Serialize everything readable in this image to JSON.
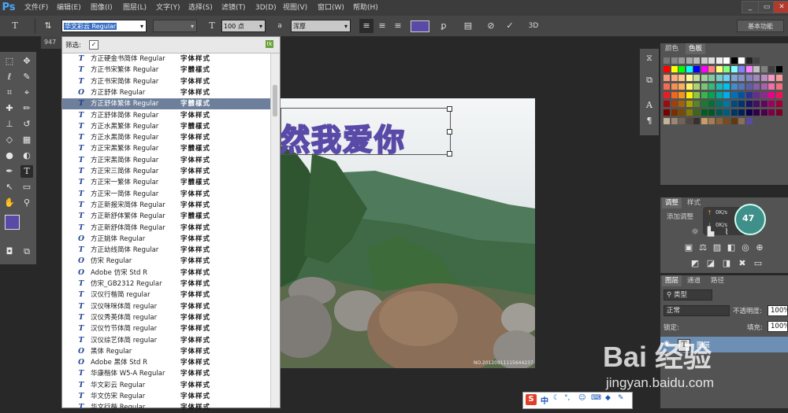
{
  "app": {
    "logo": "Ps"
  },
  "menu": [
    "文件(F)",
    "编辑(E)",
    "图像(I)",
    "图层(L)",
    "文字(Y)",
    "选择(S)",
    "滤镜(T)",
    "3D(D)",
    "视图(V)",
    "窗口(W)",
    "帮助(H)"
  ],
  "options": {
    "font_family": "华文彩云 Regular",
    "font_size": "100 点",
    "aa_label": "a",
    "aa_method": "浑厚",
    "three_d": "3D",
    "workspace": "基本功能"
  },
  "doc_tab": "947",
  "font_panel": {
    "filter_label": "筛选:",
    "fonts": [
      {
        "icon": "T",
        "name": "方正硬金书简体 Regular",
        "sample": "字体样式"
      },
      {
        "icon": "T",
        "name": "方正书宋繁体 Regular",
        "sample": "字體樣式"
      },
      {
        "icon": "T",
        "name": "方正书宋简体 Regular",
        "sample": "字体样式"
      },
      {
        "icon": "O",
        "name": "方正舒体 Regular",
        "sample": "字体样式"
      },
      {
        "icon": "T",
        "name": "方正舒体繁体 Regular",
        "sample": "字體樣式",
        "selected": true
      },
      {
        "icon": "T",
        "name": "方正舒体简体 Regular",
        "sample": "字体样式"
      },
      {
        "icon": "T",
        "name": "方正水黑繁体 Regular",
        "sample": "字體樣式"
      },
      {
        "icon": "T",
        "name": "方正水黑简体 Regular",
        "sample": "字体样式"
      },
      {
        "icon": "T",
        "name": "方正宋黑繁体 Regular",
        "sample": "字體樣式"
      },
      {
        "icon": "T",
        "name": "方正宋黑简体 Regular",
        "sample": "字体样式"
      },
      {
        "icon": "T",
        "name": "方正宋三简体 Regular",
        "sample": "字体样式"
      },
      {
        "icon": "T",
        "name": "方正宋一繁体 Regular",
        "sample": "字體樣式"
      },
      {
        "icon": "T",
        "name": "方正宋一简体 Regular",
        "sample": "字体样式"
      },
      {
        "icon": "T",
        "name": "方正新报宋简体 Regular",
        "sample": "字体样式"
      },
      {
        "icon": "T",
        "name": "方正新舒体繁体 Regular",
        "sample": "字體樣式"
      },
      {
        "icon": "T",
        "name": "方正新舒体简体 Regular",
        "sample": "字体样式"
      },
      {
        "icon": "O",
        "name": "方正姚体 Regular",
        "sample": "字体样式"
      },
      {
        "icon": "T",
        "name": "方正幼线简体 Regular",
        "sample": "字体样式"
      },
      {
        "icon": "O",
        "name": "仿宋 Regular",
        "sample": "字体样式"
      },
      {
        "icon": "O",
        "name": "Adobe 仿宋 Std R",
        "sample": "字体样式"
      },
      {
        "icon": "T",
        "name": "仿宋_GB2312 Regular",
        "sample": "字体样式"
      },
      {
        "icon": "T",
        "name": "汉仪行楷简 regular",
        "sample": "字体样式"
      },
      {
        "icon": "T",
        "name": "汉仪咪咪体简 regular",
        "sample": "字体样式"
      },
      {
        "icon": "T",
        "name": "汉仪秀英体简 regular",
        "sample": "字体样式"
      },
      {
        "icon": "T",
        "name": "汉仪竹节体简 regular",
        "sample": "字体样式"
      },
      {
        "icon": "T",
        "name": "汉仪综艺体简 regular",
        "sample": "字体样式"
      },
      {
        "icon": "O",
        "name": "黑体 Regular",
        "sample": "字体样式"
      },
      {
        "icon": "O",
        "name": "Adobe 黑体 Std R",
        "sample": "字体样式"
      },
      {
        "icon": "T",
        "name": "华康楷体 W5-A Regular",
        "sample": "字体样式"
      },
      {
        "icon": "T",
        "name": "华文彩云 Regular",
        "sample": "字体样式"
      },
      {
        "icon": "T",
        "name": "华文仿宋 Regular",
        "sample": "字体样式"
      },
      {
        "icon": "T",
        "name": "华文行楷 Regular",
        "sample": "字体样式"
      }
    ]
  },
  "canvas": {
    "text": "然我爱你",
    "photo_stamp": "NO.20120911115644237"
  },
  "panels": {
    "swatch_tabs": [
      "颜色",
      "色板"
    ],
    "adj_tabs": [
      "调整",
      "样式"
    ],
    "adj_hint": "添加调整",
    "speed_up": "0K/s",
    "speed_down": "0K/s",
    "speed_pct": "47",
    "layer_tabs": [
      "图层",
      "通道",
      "路径"
    ],
    "kind": "类型",
    "blend": "正常",
    "opacity_label": "不透明度:",
    "opacity": "100%",
    "lock_label": "锁定:",
    "fill_label": "填充:",
    "fill": "100%",
    "layer_name": "图层"
  },
  "ime": {
    "logo": "S",
    "mode": "中"
  },
  "watermark": {
    "brand": "Bai 经验",
    "url": "jingyan.baidu.com"
  },
  "colors": {
    "foreground": "#5a4aa8",
    "background": "#ffffff",
    "selection": "#6d7f9a",
    "accent": "#4aa8ff"
  }
}
